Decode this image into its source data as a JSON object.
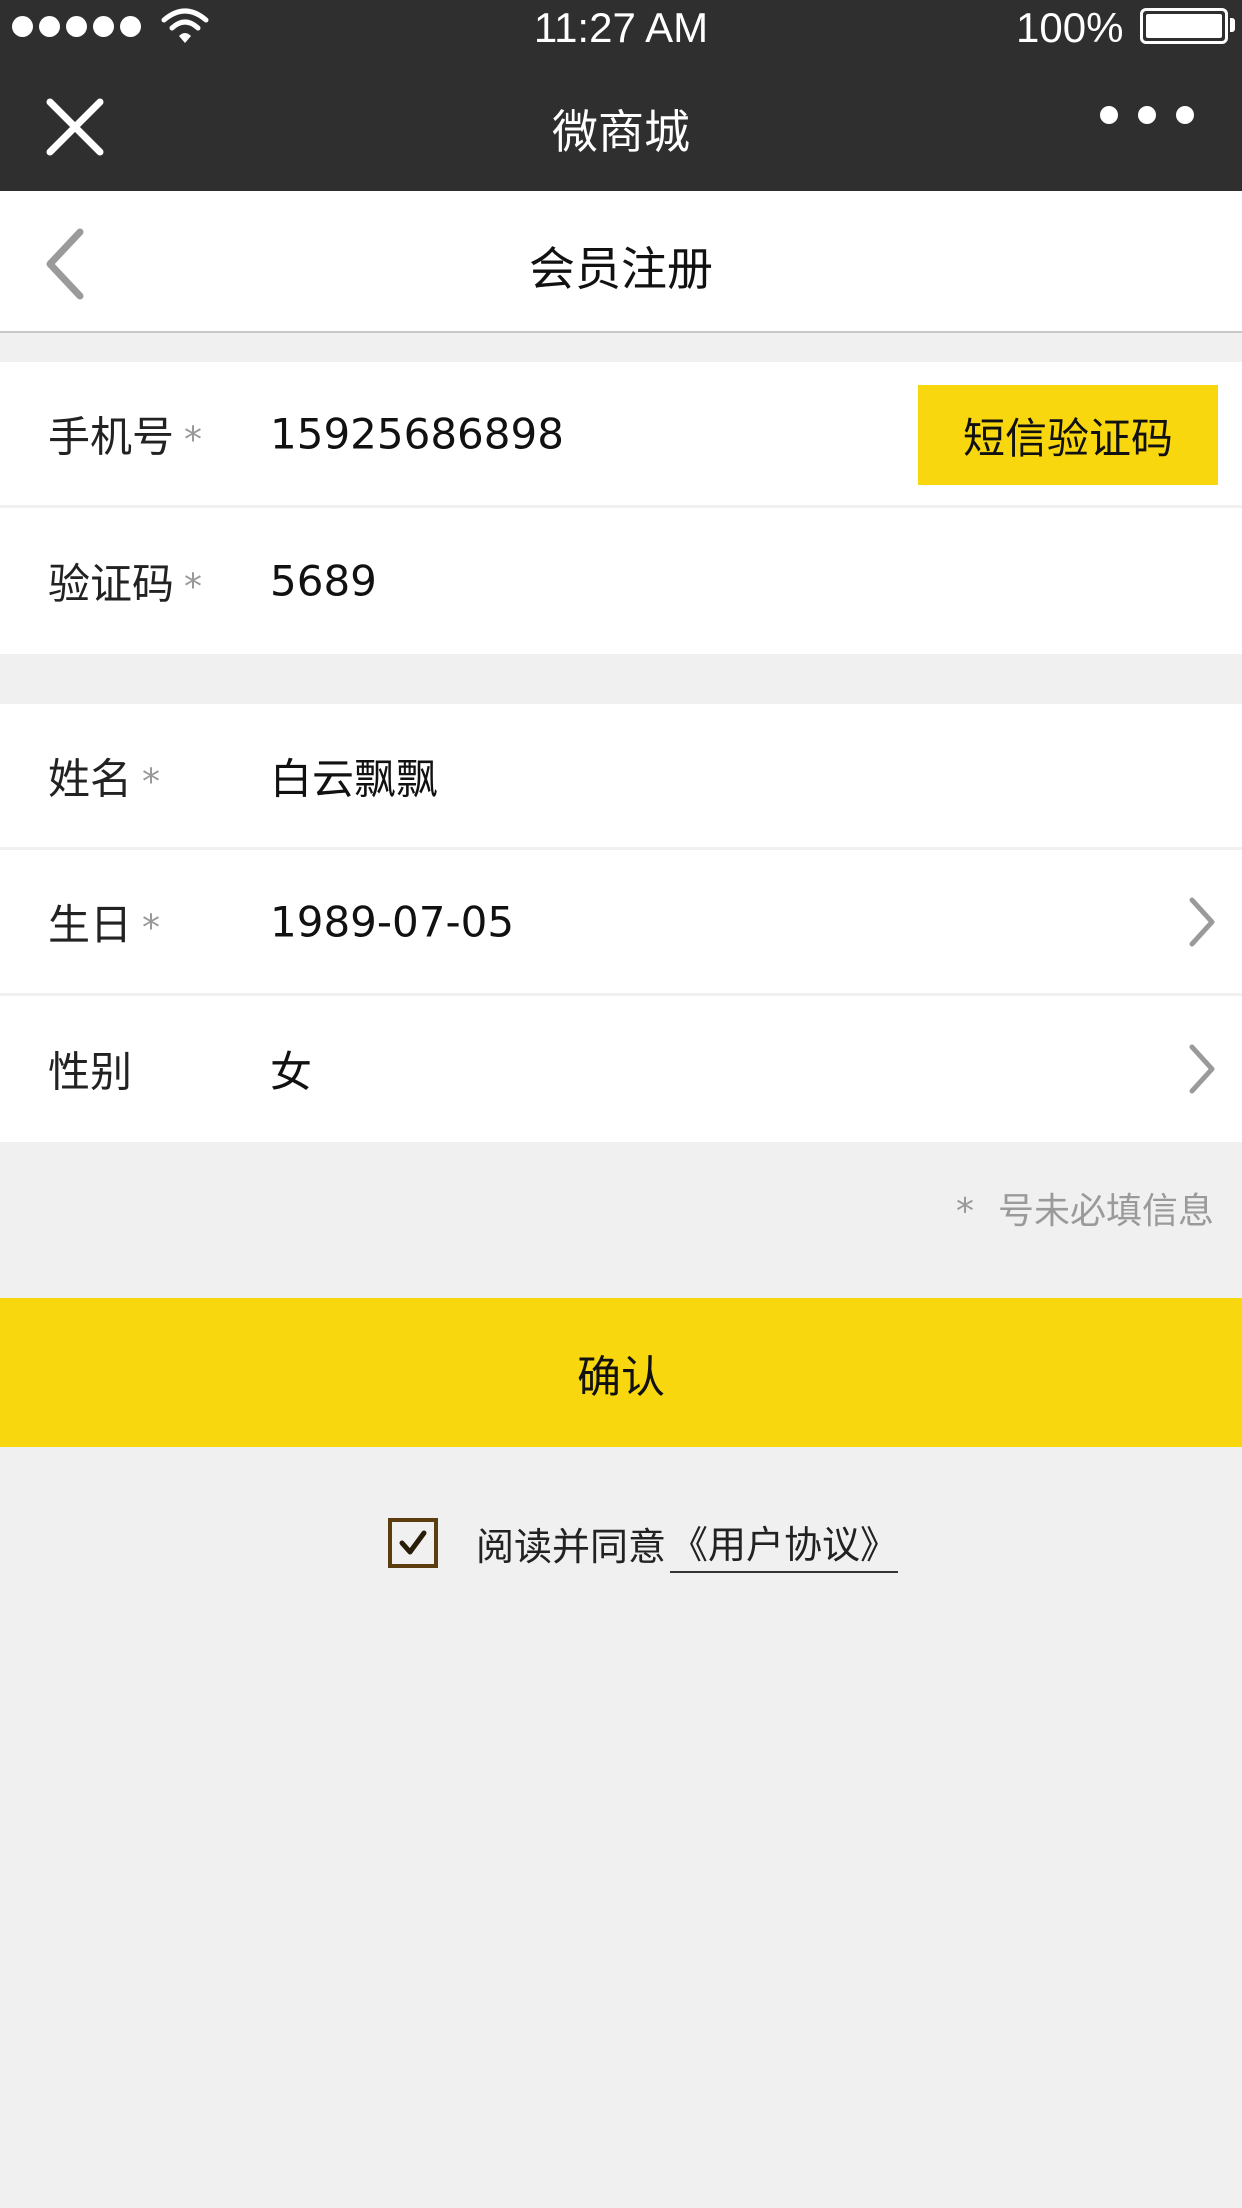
{
  "status_bar": {
    "time": "11:27 AM",
    "battery": "100%",
    "signal_dots": 5
  },
  "nav": {
    "title": "微商城",
    "close_icon": "close-icon",
    "more_icon": "more-icon"
  },
  "header": {
    "title": "会员注册",
    "back_icon": "chevron-left-icon"
  },
  "form": {
    "required_mark": "*",
    "phone": {
      "label": "手机号",
      "value": "15925686898"
    },
    "sms_button": "短信验证码",
    "code": {
      "label": "验证码",
      "value": "5689"
    },
    "name": {
      "label": "姓名",
      "value": "白云飘飘"
    },
    "birthday": {
      "label": "生日",
      "value": "1989-07-05"
    },
    "gender": {
      "label": "性别",
      "value": "女"
    }
  },
  "note": {
    "star": "*",
    "text": "号未必填信息"
  },
  "confirm_button": "确认",
  "agreement": {
    "checked": true,
    "text": "阅读并同意",
    "link": "《用户协议》"
  },
  "colors": {
    "accent": "#f9d70f",
    "nav_bg": "#2f2f2f",
    "page_bg": "#f0f0f0",
    "checkbox_border": "#5c3d10"
  }
}
